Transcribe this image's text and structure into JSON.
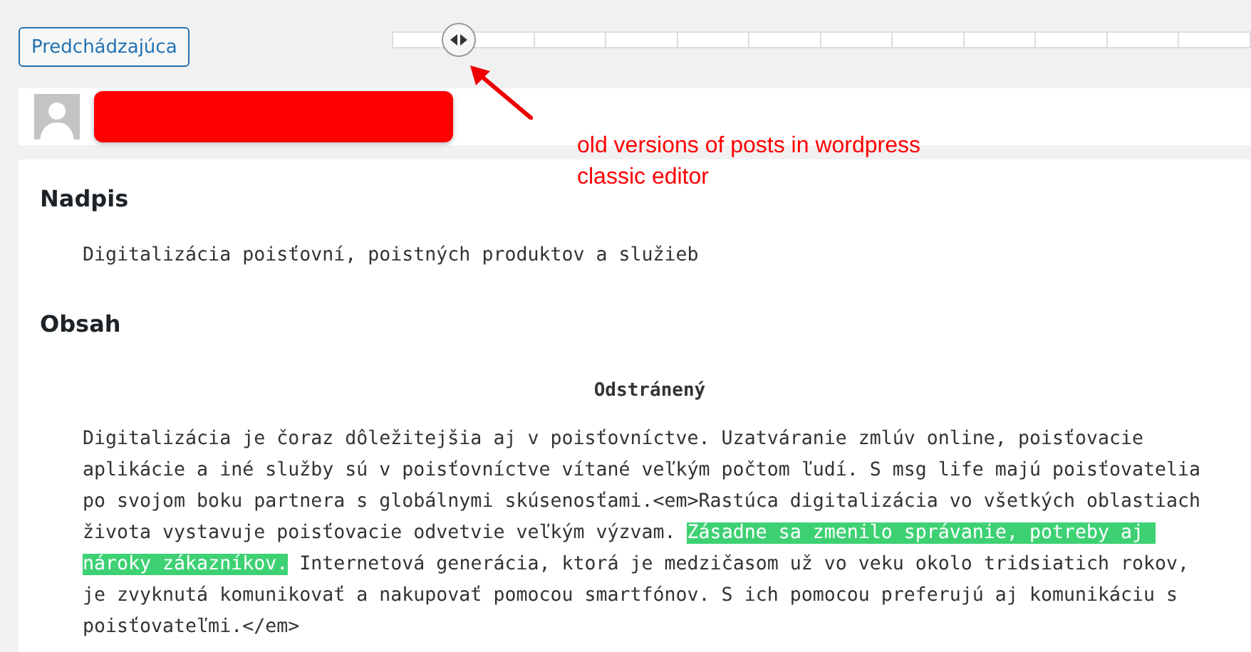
{
  "previous_button": "Predchádzajúca",
  "revision_slider": {
    "level": 0.077
  },
  "annotation": "old versions of posts in wordpress classic editor",
  "sections": [
    {
      "heading": "Nadpis",
      "kind": "plain",
      "text": "Digitalizácia poisťovní, poistných produktov a služieb"
    },
    {
      "heading": "Obsah",
      "kind": "diff",
      "label": "Odstránený",
      "segments": [
        {
          "text": "Digitalizácia je čoraz dôležitejšia aj v poisťovníctve. Uzatváranie zmlúv online, poisťovacie aplikácie a iné služby sú v poisťovníctve vítané veľkým počtom ľudí. S msg life majú poisťovatelia po svojom boku partnera s globálnymi skúsenosťami.<em>Rastúca digitalizácia vo všetkých oblastiach života vystavuje poisťovacie odvetvie veľkým výzvam. ",
          "highlighted": false
        },
        {
          "text": "Zásadne sa zmenilo správanie, potreby aj nároky zákazníkov.",
          "highlighted": true
        },
        {
          "text": " Internetová generácia, ktorá je medzičasom už vo veku okolo tridsiatich rokov, je zvyknutá komunikovať a nakupovať pomocou smartfónov. S ich pomocou preferujú aj komunikáciu s poisťovateľmi.</em>",
          "highlighted": false
        }
      ]
    }
  ]
}
